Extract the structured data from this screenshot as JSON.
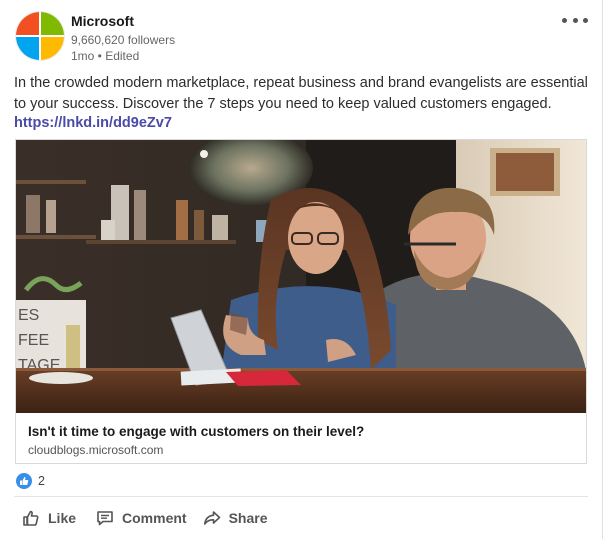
{
  "company": {
    "name": "Microsoft",
    "followers": "9,660,620 followers",
    "meta": "1mo • Edited",
    "logo_colors": [
      "#f25022",
      "#7fba00",
      "#00a4ef",
      "#ffb900"
    ]
  },
  "post": {
    "text": "In the crowded modern marketplace, repeat business and brand evangelists are essential to your success. Discover the 7 steps you need to keep valued customers engaged.",
    "link": "https://lnkd.in/dd9eZv7"
  },
  "article": {
    "title": "Isn't it time to engage with customers on their level?",
    "domain": "cloudblogs.microsoft.com",
    "image_desc_icon": "photo-two-people-at-tablet",
    "sign_text": [
      "ES",
      "FEE",
      "TAGE"
    ]
  },
  "reactions": {
    "icon": "like-reaction-icon",
    "count": "2",
    "accent": "#378fe9"
  },
  "actions": {
    "like": "Like",
    "comment": "Comment",
    "share": "Share"
  }
}
